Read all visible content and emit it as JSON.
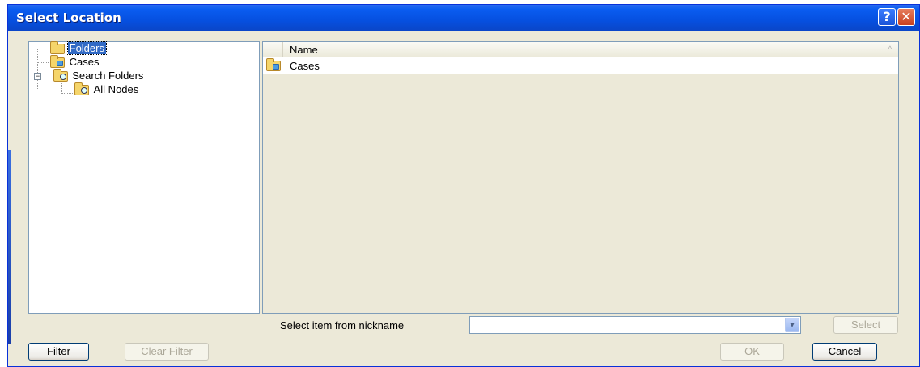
{
  "dialog": {
    "title": "Select Location",
    "help_glyph": "?",
    "close_glyph": "✕"
  },
  "tree": {
    "items": [
      {
        "label": "Folders",
        "icon": "folder-icon",
        "selected": true
      },
      {
        "label": "Cases",
        "icon": "cases-folder-icon",
        "selected": false
      },
      {
        "label": "Search Folders",
        "icon": "search-folder-icon",
        "expander": "−",
        "selected": false
      },
      {
        "label": "All Nodes",
        "icon": "search-folder-icon",
        "selected": false
      }
    ]
  },
  "list": {
    "column_header": "Name",
    "sort_glyph": "^",
    "rows": [
      {
        "name": "Cases",
        "icon": "cases-folder-icon"
      }
    ]
  },
  "nickname": {
    "label": "Select item from nickname",
    "value": "",
    "dropdown_glyph": "▾"
  },
  "buttons": {
    "filter": "Filter",
    "clear_filter": "Clear Filter",
    "select": "Select",
    "ok": "OK",
    "cancel": "Cancel"
  },
  "colors": {
    "titlebar": "#0a5cf0",
    "dialog_bg": "#ece9d8",
    "selection": "#316ac5"
  }
}
